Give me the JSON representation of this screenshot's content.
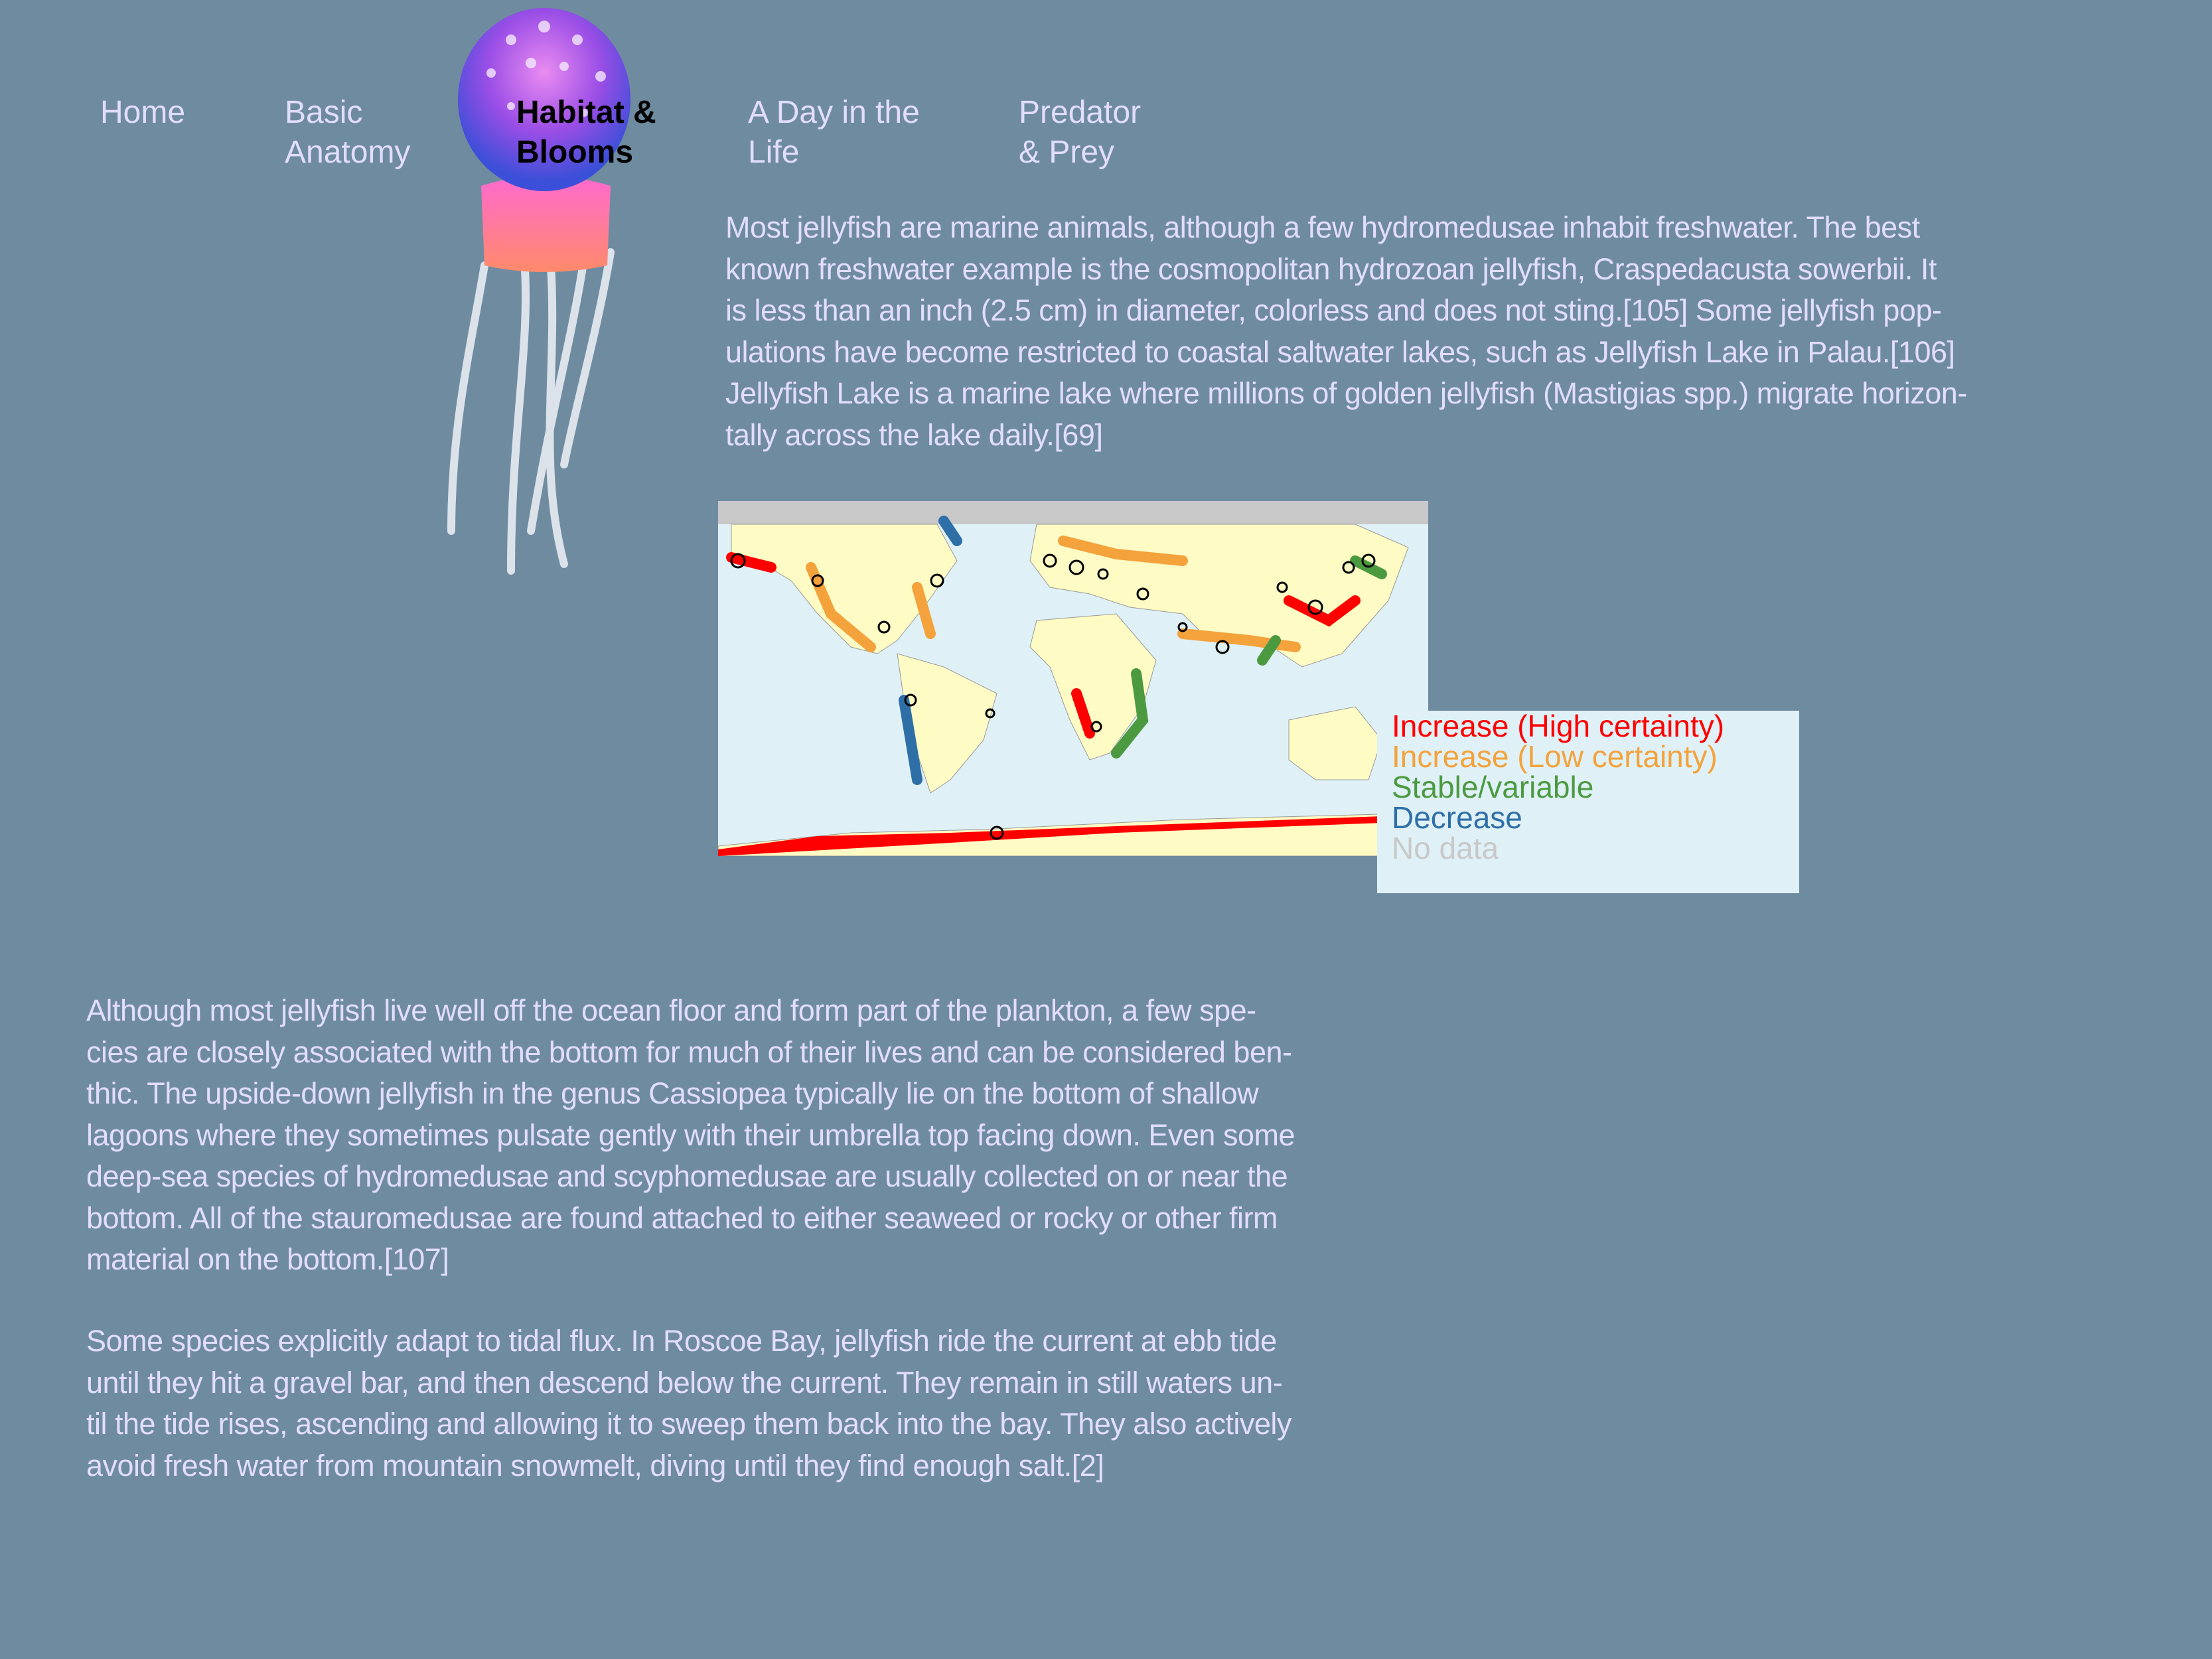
{
  "nav": {
    "items": [
      {
        "label_lines": [
          "Home"
        ]
      },
      {
        "label_lines": [
          "Basic",
          "Anatomy"
        ]
      },
      {
        "label_lines": [
          "Habitat &",
          "Blooms"
        ],
        "active": true
      },
      {
        "label_lines": [
          "A Day in the",
          "Life"
        ]
      },
      {
        "label_lines": [
          "Predator",
          "& Prey"
        ]
      }
    ]
  },
  "intro_paragraph": [
    "Most jellyfish are marine animals, although a few hydromedusae inhabit freshwater. The best",
    "known freshwater example is the cosmopolitan hydrozoan jellyfish, Craspedacusta sowerbii. It",
    "is less than an inch (2.5 cm) in diameter, colorless and does not sting.[105] Some jellyfish pop-",
    "ulations have become restricted to coastal saltwater lakes, such as Jellyfish Lake in Palau.[106]",
    "Jellyfish Lake is a marine lake where millions of golden jellyfish (Mastigias spp.) migrate horizon-",
    "tally across the lake daily.[69]"
  ],
  "map_legend": [
    {
      "label": "Increase (High certainty)",
      "color": "#ff0000"
    },
    {
      "label": "Increase (Low certainty)",
      "color": "#f4a23c"
    },
    {
      "label": "Stable/variable",
      "color": "#4c9a40"
    },
    {
      "label": "Decrease",
      "color": "#2f6fa8"
    },
    {
      "label": "No data",
      "color": "#c8c8c8"
    }
  ],
  "benthic_paragraph": [
    "Although most jellyfish live well off the ocean floor and form part of the plankton, a few spe-",
    "cies are closely associated with the bottom for much of their lives and can be considered ben-",
    "thic. The upside-down jellyfish in the genus Cassiopea typically lie on the bottom of shallow",
    "lagoons where they sometimes pulsate gently with their umbrella top facing down. Even some",
    "deep-sea species of hydromedusae and scyphomedusae are usually collected on or near the",
    "bottom. All of the stauromedusae are found attached to either seaweed or rocky or other firm",
    "material on the bottom.[107]"
  ],
  "tidal_paragraph": [
    "Some species explicitly adapt to tidal flux. In Roscoe Bay, jellyfish ride the current at ebb tide",
    "until they hit a gravel bar, and then descend below the current. They remain in still waters un-",
    "til the tide rises, ascending and allowing it to sweep them back into the bay. They also actively",
    "avoid fresh water from mountain snowmelt, diving until they find enough salt.[2]"
  ]
}
